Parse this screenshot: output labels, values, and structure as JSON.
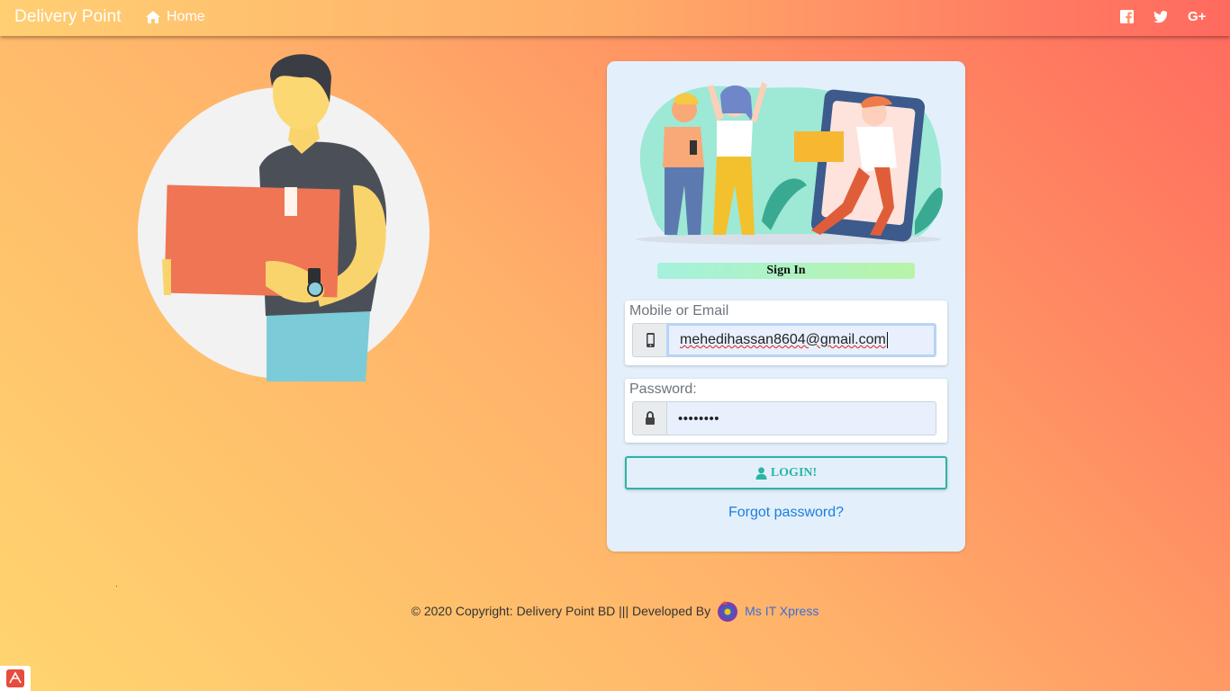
{
  "nav": {
    "brand": "Delivery Point",
    "home_label": "Home",
    "social": [
      {
        "name": "facebook-icon"
      },
      {
        "name": "twitter-icon"
      },
      {
        "name": "google-plus-icon",
        "text": "G+"
      }
    ]
  },
  "login": {
    "heading": "Sign In",
    "email_label": "Mobile or Email",
    "email_value": "mehedihassan8604@gmail.com",
    "password_label": "Password:",
    "password_value": "••••••••",
    "login_button": "LOGIN!",
    "forgot_link": "Forgot password?"
  },
  "footer": {
    "copyright": "© 2020 Copyright: Delivery Point BD ||| Developed By",
    "developer": "Ms IT Xpress"
  },
  "colors": {
    "accent_teal": "#2bb5a3",
    "link_blue": "#1a7fe0",
    "card_bg": "#e3f0fb"
  }
}
